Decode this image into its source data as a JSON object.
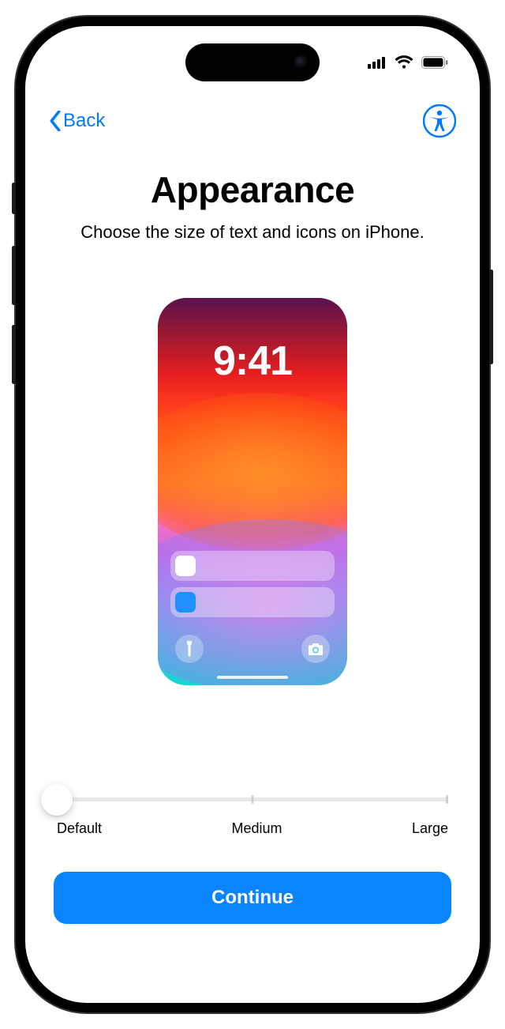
{
  "nav": {
    "back_label": "Back"
  },
  "page": {
    "title": "Appearance",
    "subtitle": "Choose the size of text and icons on iPhone."
  },
  "preview": {
    "time": "9:41"
  },
  "slider": {
    "labels": [
      "Default",
      "Medium",
      "Large"
    ],
    "selected_index": 0
  },
  "actions": {
    "continue_label": "Continue"
  },
  "icons": {
    "back_chevron": "chevron-left-icon",
    "accessibility": "accessibility-icon",
    "cellular": "cellular-icon",
    "wifi": "wifi-icon",
    "battery": "battery-icon",
    "flashlight": "flashlight-icon",
    "camera": "camera-icon"
  }
}
